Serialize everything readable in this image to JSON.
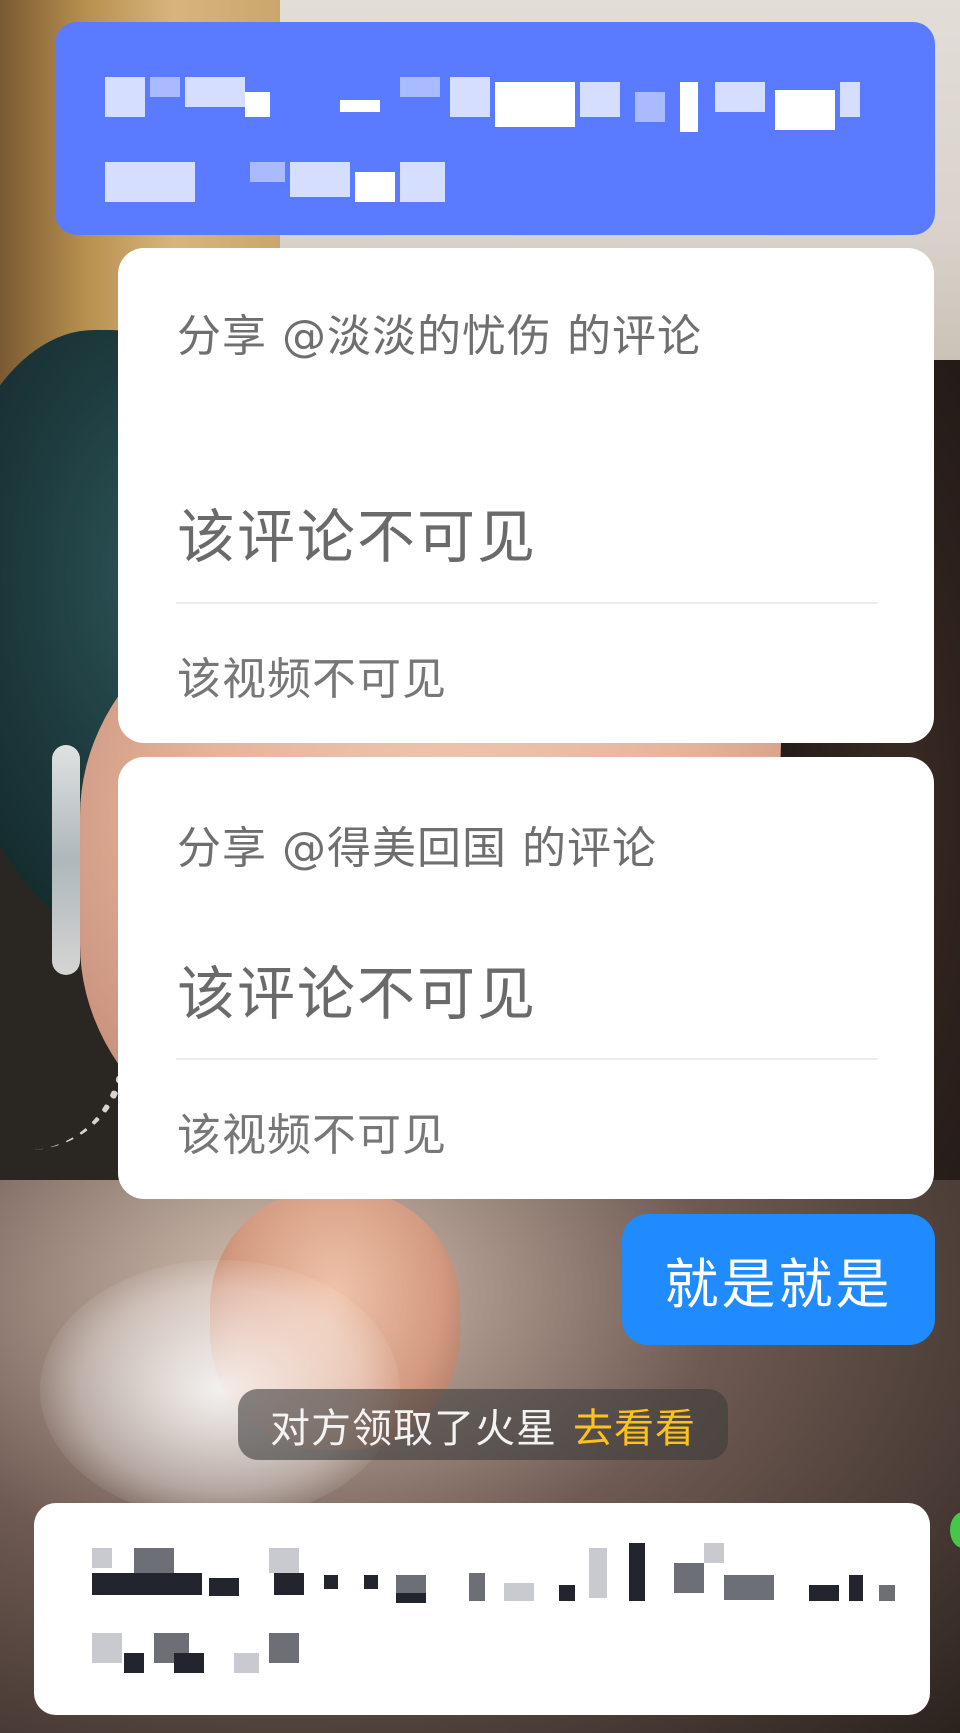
{
  "messages": {
    "top_bubble": {
      "blurred": true,
      "color": "#5a7bff"
    },
    "shared_comments": [
      {
        "share_label": "分享 @淡淡的忧伤 的评论",
        "comment_text": "该评论不可见",
        "video_text": "该视频不可见"
      },
      {
        "share_label": "分享 @得美回国 的评论",
        "comment_text": "该评论不可见",
        "video_text": "该视频不可见"
      }
    ],
    "sent_bubble": {
      "text": "就是就是",
      "color": "#1f8bff"
    },
    "system_notice": {
      "text": "对方领取了火星",
      "link": "去看看",
      "link_color": "#ffc21a"
    },
    "bottom_bubble": {
      "blurred": true,
      "color": "#ffffff"
    }
  }
}
